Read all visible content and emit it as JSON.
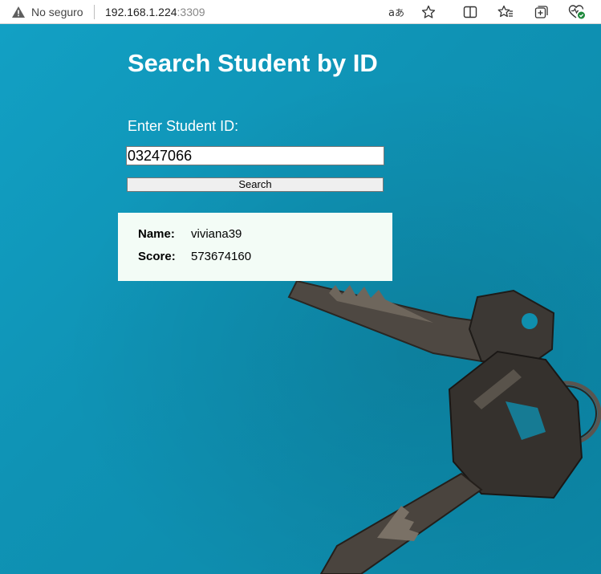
{
  "browser": {
    "security_label": "No seguro",
    "url_host": "192.168.1.224",
    "url_port": ":3309"
  },
  "page": {
    "title": "Search Student by ID",
    "input_label": "Enter Student ID:",
    "student_id_value": "03247066",
    "search_button_label": "Search"
  },
  "result": {
    "name_label": "Name:",
    "name_value": "viviana39",
    "score_label": "Score:",
    "score_value": "573674160"
  },
  "colors": {
    "background": "#0e8fae",
    "result_panel": "#f3fcf6",
    "title_text": "#ffffff"
  },
  "icons": [
    "warning-icon",
    "read-aloud-icon",
    "favorite-star-icon",
    "split-screen-icon",
    "favorites-icon",
    "collections-icon",
    "browser-essentials-icon"
  ]
}
